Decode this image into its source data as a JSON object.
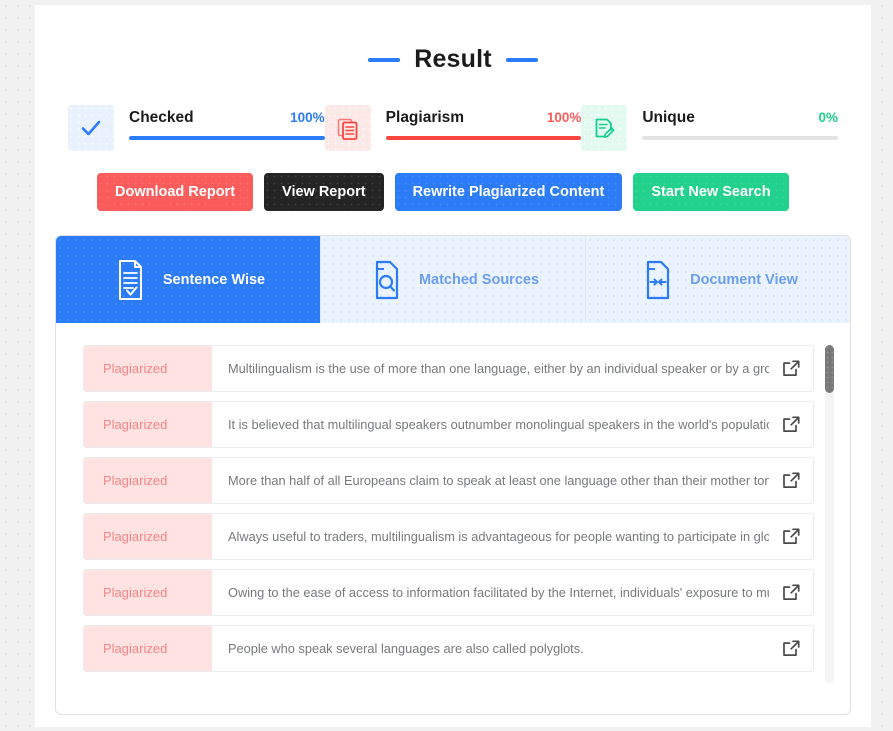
{
  "header": {
    "title": "Result"
  },
  "stats": [
    {
      "label": "Checked",
      "value": "100%",
      "percent": 100,
      "color": "#2b7cf6",
      "icon": "check-icon",
      "tone": "blue"
    },
    {
      "label": "Plagiarism",
      "value": "100%",
      "percent": 100,
      "color": "#f9453f",
      "icon": "copy-documents-icon",
      "tone": "red"
    },
    {
      "label": "Unique",
      "value": "0%",
      "percent": 0,
      "color": "#1fd18a",
      "icon": "edit-document-icon",
      "tone": "green"
    }
  ],
  "actions": [
    {
      "label": "Download Report",
      "tone": "red"
    },
    {
      "label": "View Report",
      "tone": "dark"
    },
    {
      "label": "Rewrite Plagiarized Content",
      "tone": "blue"
    },
    {
      "label": "Start New Search",
      "tone": "green"
    }
  ],
  "tabs": [
    {
      "label": "Sentence Wise",
      "icon": "document-check-icon",
      "active": true
    },
    {
      "label": "Matched Sources",
      "icon": "document-search-icon",
      "active": false
    },
    {
      "label": "Document View",
      "icon": "document-arrows-icon",
      "active": false
    }
  ],
  "sentences": [
    {
      "status": "Plagiarized",
      "text": "Multilingualism is the use of more than one language, either by an individual speaker or by a grou…",
      "link_icon": "external-link-icon"
    },
    {
      "status": "Plagiarized",
      "text": "It is believed that multilingual speakers outnumber monolingual speakers in the world's population.",
      "link_icon": "external-link-icon"
    },
    {
      "status": "Plagiarized",
      "text": "More than half of all Europeans claim to speak at least one language other than their mother tong…",
      "link_icon": "external-link-icon"
    },
    {
      "status": "Plagiarized",
      "text": "Always useful to traders, multilingualism is advantageous for people wanting to participate in glob…",
      "link_icon": "external-link-icon"
    },
    {
      "status": "Plagiarized",
      "text": "Owing to the ease of access to information facilitated by the Internet, individuals' exposure to mult…",
      "link_icon": "external-link-icon"
    },
    {
      "status": "Plagiarized",
      "text": "People who speak several languages are also called polyglots.",
      "link_icon": "external-link-icon"
    }
  ],
  "colors": {
    "accent_blue": "#2b7cf6",
    "accent_red": "#fa5c5c",
    "accent_green": "#21d18c",
    "badge_bg": "#ffe2e2",
    "badge_text": "#f78585"
  }
}
